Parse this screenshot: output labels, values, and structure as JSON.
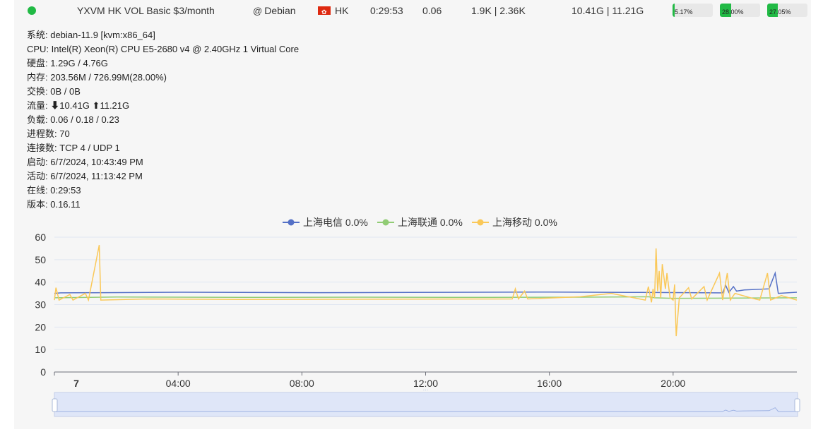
{
  "server": {
    "name": "YXVM HK VOL Basic $3/month",
    "os": "Debian",
    "region": "HK",
    "uptime": "0:29:53",
    "load": "0.06",
    "network_speed": "1.9K | 2.36K",
    "traffic": "10.41G | 11.21G",
    "cpu_percent": 5.17,
    "cpu_label": "5.17%",
    "mem_percent": 28.0,
    "mem_label": "28.00%",
    "disk_percent": 27.05,
    "disk_label": "27.05%",
    "status_color": "#21ba45"
  },
  "details": {
    "system": "系统: debian-11.9 [kvm:x86_64]",
    "cpu": "CPU: Intel(R) Xeon(R) CPU E5-2680 v4 @ 2.40GHz 1 Virtual Core",
    "disk": "硬盘: 1.29G / 4.76G",
    "memory": "内存: 203.56M / 726.99M(28.00%)",
    "swap": "交换: 0B / 0B",
    "traffic_label": "流量:",
    "traffic_down": "10.41G",
    "traffic_up": "11.21G",
    "load": "负载: 0.06 / 0.18 / 0.23",
    "processes": "进程数: 70",
    "connections": "连接数: TCP 4 / UDP 1",
    "boot": "启动: 6/7/2024, 10:43:49 PM",
    "active": "活动: 6/7/2024, 11:13:42 PM",
    "online": "在线: 0:29:53",
    "version": "版本: 0.16.11"
  },
  "chart_data": {
    "type": "line",
    "title": "",
    "xlabel": "",
    "ylabel": "",
    "ylim": [
      0,
      60
    ],
    "yticks": [
      0,
      10,
      20,
      30,
      40,
      50,
      60
    ],
    "xticks": [
      "7",
      "04:00",
      "08:00",
      "12:00",
      "16:00",
      "20:00"
    ],
    "xrange_hours": [
      0,
      24
    ],
    "grid": true,
    "legend_position": "top-center",
    "series": [
      {
        "name": "上海电信 0.0%",
        "color": "#5470c6",
        "baseline": 35,
        "points": [
          [
            0,
            35
          ],
          [
            0.2,
            35.2
          ],
          [
            4.2,
            35.5
          ],
          [
            8.5,
            35.3
          ],
          [
            11.5,
            35.4
          ],
          [
            16,
            35.6
          ],
          [
            19,
            35.4
          ],
          [
            21.6,
            35.2
          ],
          [
            21.7,
            38.5
          ],
          [
            21.8,
            35.4
          ],
          [
            21.95,
            38
          ],
          [
            22.05,
            36
          ],
          [
            22.3,
            36.5
          ],
          [
            23.1,
            37
          ],
          [
            23.3,
            44
          ],
          [
            23.4,
            35
          ],
          [
            24,
            35.5
          ]
        ]
      },
      {
        "name": "上海联通 0.0%",
        "color": "#91cc75",
        "baseline": 33,
        "points": [
          [
            0,
            33
          ],
          [
            2,
            33.4
          ],
          [
            6,
            33.2
          ],
          [
            10,
            33.3
          ],
          [
            14,
            33.2
          ],
          [
            17,
            33.3
          ],
          [
            19.2,
            33.5
          ],
          [
            19.4,
            33
          ],
          [
            20,
            32.8
          ],
          [
            24,
            33
          ]
        ]
      },
      {
        "name": "上海移动 0.0%",
        "color": "#fac858",
        "baseline": 32,
        "points": [
          [
            0,
            32
          ],
          [
            0.05,
            37.5
          ],
          [
            0.15,
            32
          ],
          [
            0.5,
            34.5
          ],
          [
            0.6,
            32
          ],
          [
            1,
            35
          ],
          [
            1.1,
            32
          ],
          [
            1.45,
            56.5
          ],
          [
            1.5,
            32
          ],
          [
            3,
            32.5
          ],
          [
            6,
            32.3
          ],
          [
            10,
            32.4
          ],
          [
            14.8,
            32.5
          ],
          [
            14.9,
            37
          ],
          [
            15,
            32.5
          ],
          [
            15.2,
            36
          ],
          [
            15.3,
            32.5
          ],
          [
            17,
            33.5
          ],
          [
            18,
            35
          ],
          [
            19.1,
            32
          ],
          [
            19.2,
            38
          ],
          [
            19.3,
            31
          ],
          [
            19.35,
            37
          ],
          [
            19.4,
            33
          ],
          [
            19.45,
            55
          ],
          [
            19.5,
            36
          ],
          [
            19.55,
            45
          ],
          [
            19.6,
            33
          ],
          [
            19.65,
            48
          ],
          [
            19.75,
            37
          ],
          [
            19.8,
            44
          ],
          [
            19.9,
            33
          ],
          [
            20,
            32
          ],
          [
            20.05,
            39
          ],
          [
            20.1,
            16
          ],
          [
            20.2,
            33
          ],
          [
            20.5,
            37.5
          ],
          [
            20.6,
            32.5
          ],
          [
            21,
            38
          ],
          [
            21.1,
            32
          ],
          [
            21.5,
            44
          ],
          [
            21.6,
            32
          ],
          [
            21.75,
            44
          ],
          [
            21.85,
            32
          ],
          [
            22,
            35
          ],
          [
            22.5,
            33
          ],
          [
            22.8,
            32
          ],
          [
            23.05,
            44
          ],
          [
            23.15,
            32
          ],
          [
            23.5,
            34
          ],
          [
            24,
            32
          ]
        ]
      }
    ]
  }
}
